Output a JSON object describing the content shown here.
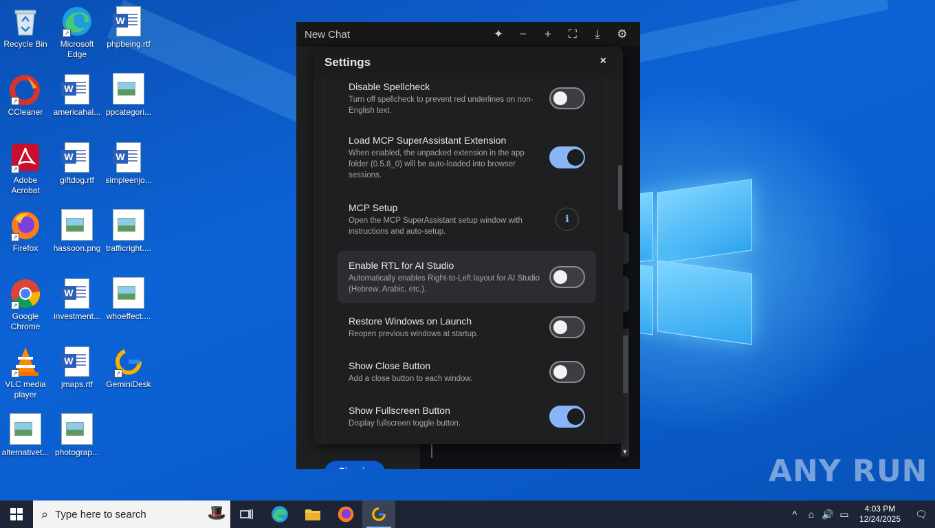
{
  "desktop": {
    "icons": [
      {
        "label": "Recycle Bin",
        "icon": "recycle-bin-icon"
      },
      {
        "label": "Microsoft Edge",
        "icon": "edge-icon"
      },
      {
        "label": "phpbeing.rtf",
        "icon": "word-doc-icon"
      },
      {
        "label": "CCleaner",
        "icon": "ccleaner-icon"
      },
      {
        "label": "americahal...",
        "icon": "word-doc-icon"
      },
      {
        "label": "ppcategori...",
        "icon": "image-file-icon"
      },
      {
        "label": "Adobe Acrobat",
        "icon": "acrobat-icon"
      },
      {
        "label": "giftdog.rtf",
        "icon": "word-doc-icon"
      },
      {
        "label": "simpleenjo...",
        "icon": "word-doc-icon"
      },
      {
        "label": "Firefox",
        "icon": "firefox-icon"
      },
      {
        "label": "hassoon.png",
        "icon": "image-file-icon"
      },
      {
        "label": "trafficright....",
        "icon": "image-file-icon"
      },
      {
        "label": "Google Chrome",
        "icon": "chrome-icon"
      },
      {
        "label": "investment...",
        "icon": "word-doc-icon"
      },
      {
        "label": "whoeffect....",
        "icon": "image-file-icon"
      },
      {
        "label": "VLC media player",
        "icon": "vlc-icon"
      },
      {
        "label": "jmaps.rtf",
        "icon": "word-doc-icon"
      },
      {
        "label": "GeminiDesk",
        "icon": "geminidesk-icon"
      },
      {
        "label": "alternativet...",
        "icon": "image-file-icon"
      },
      {
        "label": "photograp...",
        "icon": "image-file-icon"
      }
    ]
  },
  "app_window": {
    "title": "New Chat",
    "controls": [
      "sparkle-icon",
      "minimize-icon",
      "new-window-icon",
      "fullscreen-icon",
      "download-icon",
      "gear-icon"
    ],
    "sign_in_label": "Sign in"
  },
  "settings": {
    "title": "Settings",
    "close_symbol": "×",
    "items": [
      {
        "title": "Disable Spellcheck",
        "desc": "Turn off spellcheck to prevent red underlines on non-English text.",
        "control": "toggle",
        "on": false
      },
      {
        "title": "Load MCP SuperAssistant Extension",
        "desc": "When enabled, the unpacked extension in the app folder (0.5.8_0) will be auto-loaded into browser sessions.",
        "control": "toggle",
        "on": true
      },
      {
        "title": "MCP Setup",
        "desc": "Open the MCP SuperAssistant setup window with instructions and auto-setup.",
        "control": "info",
        "info_symbol": "i"
      },
      {
        "title": "Enable RTL for AI Studio",
        "desc": "Automatically enables Right-to-Left layout for AI Studio (Hebrew, Arabic, etc.).",
        "control": "toggle",
        "on": false
      },
      {
        "title": "Restore Windows on Launch",
        "desc": "Reopen previous windows at startup.",
        "control": "toggle",
        "on": false
      },
      {
        "title": "Show Close Button",
        "desc": "Add a close button to each window.",
        "control": "toggle",
        "on": false
      },
      {
        "title": "Show Fullscreen Button",
        "desc": "Display fullscreen toggle button.",
        "control": "toggle",
        "on": true
      }
    ]
  },
  "taskbar": {
    "search_placeholder": "Type here to search",
    "apps": [
      "task-view-icon",
      "edge-icon",
      "file-explorer-icon",
      "firefox-icon",
      "geminidesk-icon"
    ],
    "time": "4:03 PM",
    "date": "12/24/2025"
  },
  "watermark": "ANY RUN",
  "colors": {
    "accent": "#8ab4f8",
    "dialog_bg": "#1e1f20",
    "taskbar_bg": "#1c2436"
  }
}
